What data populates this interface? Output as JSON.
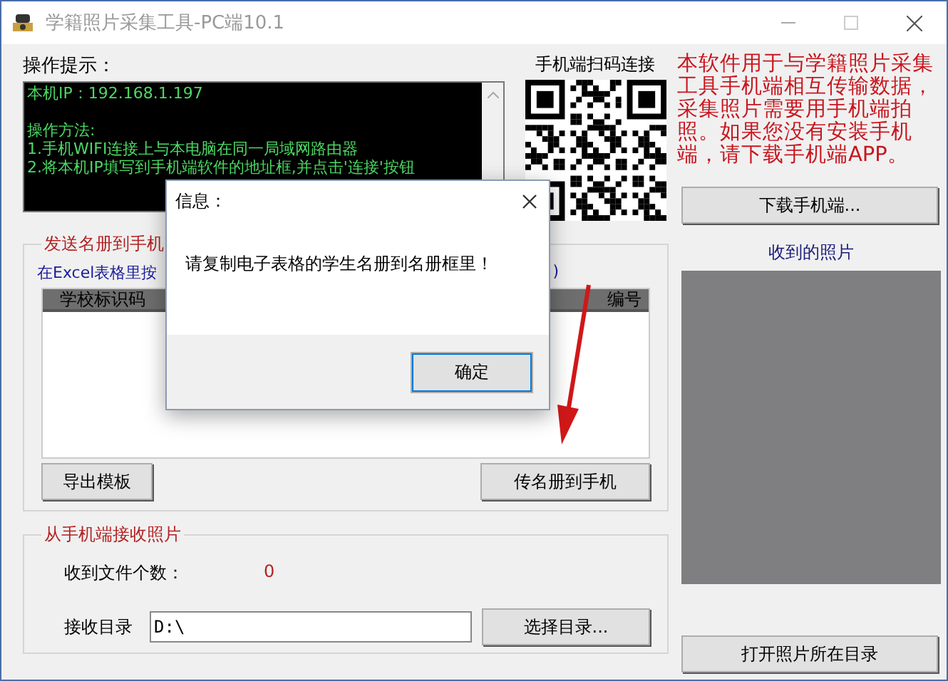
{
  "window": {
    "title": "学籍照片采集工具-PC端10.1"
  },
  "tips": {
    "label": "操作提示：",
    "lines": [
      "本机IP：192.168.1.197",
      "操作方法:",
      "1.手机WIFI连接上与本电脑在同一局域网路由器",
      "2.将本机IP填写到手机端软件的地址框,并点击'连接'按钮"
    ]
  },
  "qr": {
    "label": "手机端扫码连接"
  },
  "notice": "本软件用于与学籍照片采集工具手机端相互传输数据，采集照片需要用手机端拍照。如果您没有安装手机端，请下载手机端APP。",
  "download_button": "下载手机端...",
  "send_group": {
    "title": "发送名册到手机",
    "hint_start": "在Excel表格里按",
    "hint_end": ")",
    "columns": [
      "学校标识码",
      "编号"
    ],
    "buttons": [
      "导出模板",
      "传名册到手机"
    ]
  },
  "receive_group": {
    "title": "从手机端接收照片",
    "count_label": "收到文件个数：",
    "count": "0",
    "dir_label": "接收目录",
    "dir_value": "D:\\",
    "browse_button": "选择目录..."
  },
  "photos": {
    "label": "收到的照片",
    "open_button": "打开照片所在目录"
  },
  "dialog": {
    "title": "信息：",
    "message": "请复制电子表格的学生名册到名册框里！",
    "ok_button": "确定"
  }
}
